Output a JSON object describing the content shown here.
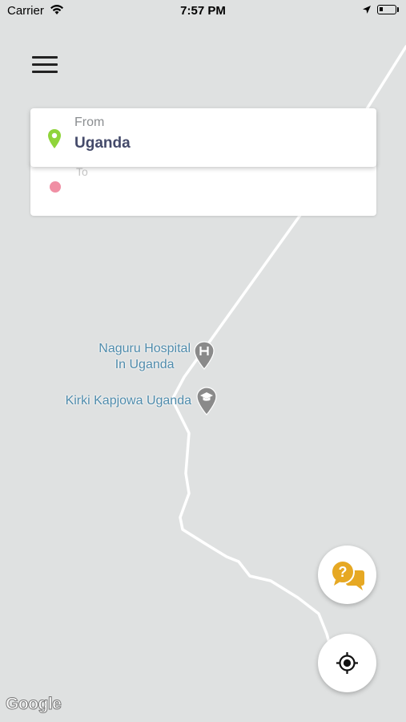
{
  "status_bar": {
    "carrier": "Carrier",
    "time": "7:57 PM"
  },
  "route_form": {
    "from_label": "From",
    "from_value": "Uganda",
    "to_label": "To",
    "to_value": ""
  },
  "map": {
    "attribution": "Google",
    "pois": [
      {
        "name_line1": "Naguru Hospital",
        "name_line2": "In Uganda",
        "icon": "hospital-icon"
      },
      {
        "name_line1": "Kirki Kapjowa Uganda",
        "icon": "school-icon"
      }
    ]
  },
  "colors": {
    "map_background": "#dfe1e1",
    "road": "#ffffff",
    "from_pin": "#8fd43a",
    "to_dot": "#f08fa4",
    "poi_text": "#4f8bab",
    "help_icon": "#e6a823",
    "from_text": "#444a6a"
  },
  "icons": {
    "menu": "hamburger-menu-icon",
    "help": "help-chat-icon",
    "locate": "my-location-icon",
    "from": "location-pin-icon",
    "to": "destination-dot-icon"
  }
}
